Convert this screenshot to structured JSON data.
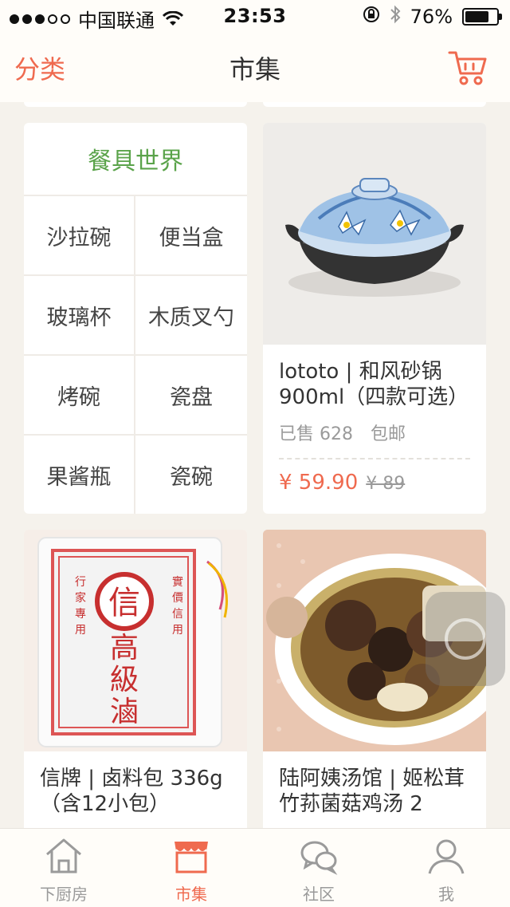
{
  "status_bar": {
    "carrier": "中国联通",
    "time": "23:53",
    "battery_percent_text": "76%",
    "battery_level": 0.76
  },
  "nav": {
    "left_label": "分类",
    "title": "市集",
    "cart_icon": "cart-icon"
  },
  "category_card": {
    "title": "餐具世界",
    "items": [
      "沙拉碗",
      "便当盒",
      "玻璃杯",
      "木质叉勺",
      "烤碗",
      "瓷盘",
      "果酱瓶",
      "瓷碗"
    ]
  },
  "products": [
    {
      "title": "lototo | 和风砂锅 900ml（四款可选）",
      "sold": "已售 628",
      "shipping": "包邮",
      "price": "¥ 59.90",
      "old_price": "¥ 89"
    },
    {
      "title": "信牌 | 卤料包 336g（含12小包）"
    },
    {
      "title": "陆阿姨汤馆 | 姬松茸竹荪菌菇鸡汤 2"
    }
  ],
  "tabs": [
    {
      "label": "下厨房",
      "icon": "house-icon",
      "active": false
    },
    {
      "label": "市集",
      "icon": "shop-icon",
      "active": true
    },
    {
      "label": "社区",
      "icon": "chat-icon",
      "active": false
    },
    {
      "label": "我",
      "icon": "person-icon",
      "active": false
    }
  ],
  "colors": {
    "accent": "#ef6a4f",
    "category_title": "#5aa34a",
    "background": "#f5f2ec"
  }
}
